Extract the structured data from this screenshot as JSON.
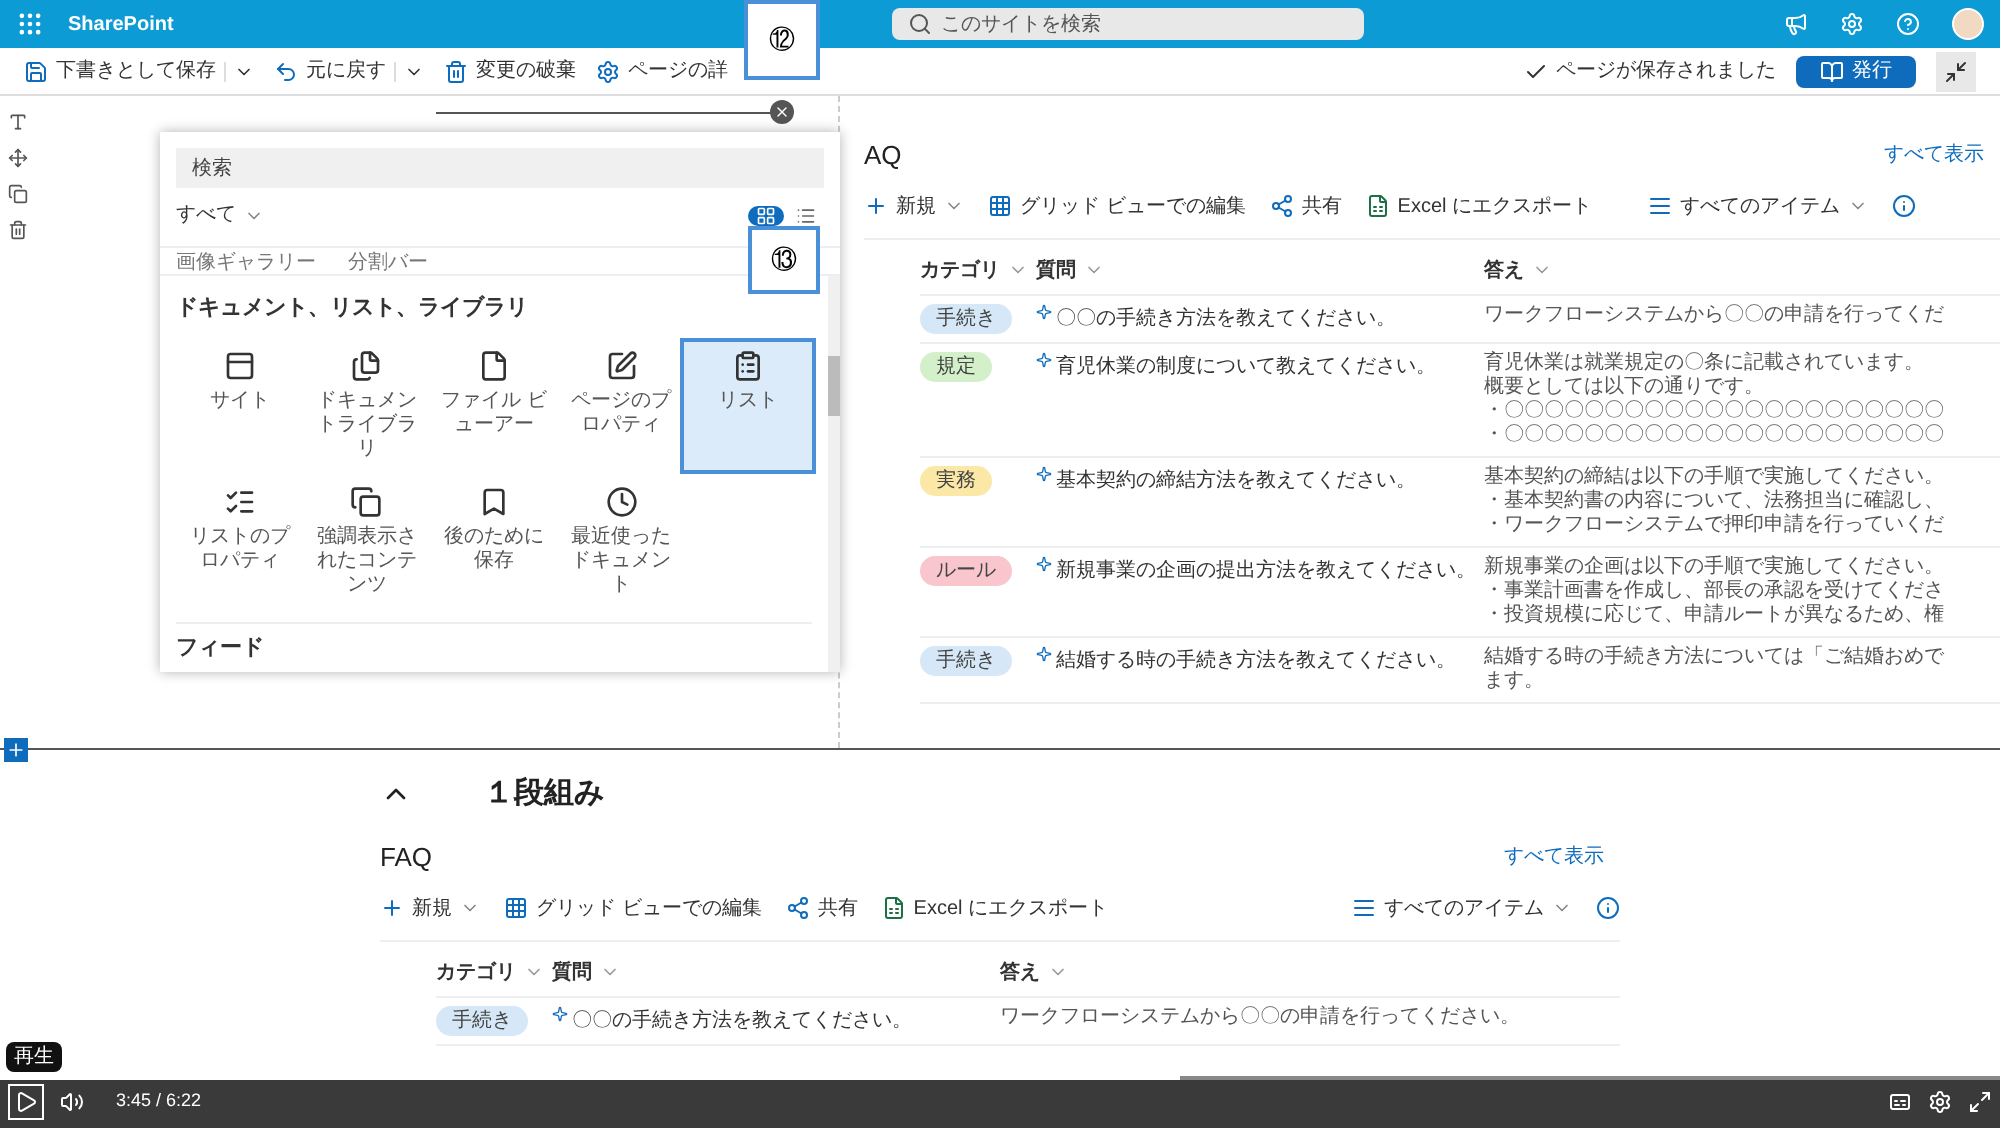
{
  "app_bar": {
    "app_name": "SharePoint",
    "search": {
      "placeholder": "このサイトを検索"
    }
  },
  "command_bar": {
    "items": [
      {
        "label": "下書きとして保存",
        "kind": "save",
        "menu": true
      },
      {
        "label": "元に戻す",
        "kind": "undo",
        "menu": true
      },
      {
        "label": "変更の破棄",
        "kind": "discard",
        "menu": false
      },
      {
        "label": "ページの詳",
        "kind": "details",
        "menu": false
      }
    ],
    "status": "ページが保存されました",
    "publish": "発行"
  },
  "annotations": [
    {
      "label": "⑫"
    },
    {
      "label": "⑬"
    }
  ],
  "picker": {
    "search_placeholder": "検索",
    "filter": "すべて",
    "grid_view": true,
    "partial_items": [
      "画像ギャラリー",
      "分割バー"
    ],
    "section": "ドキュメント、リスト、ライブラリ",
    "items": [
      {
        "label": "サイト",
        "kind": "site",
        "selected": false
      },
      {
        "label": "ドキュメントライブラリ",
        "kind": "library",
        "selected": false
      },
      {
        "label": "ファイル ビューアー",
        "kind": "file",
        "selected": false
      },
      {
        "label": "ページのプロパティ",
        "kind": "page",
        "selected": false
      },
      {
        "label": "リスト",
        "kind": "list",
        "selected": true
      },
      {
        "label": "リストのプロパティ",
        "kind": "listprops",
        "selected": false
      },
      {
        "label": "強調表示されたコンテンツ",
        "kind": "highlight",
        "selected": false
      },
      {
        "label": "後のために保存",
        "kind": "bookmark",
        "selected": false
      },
      {
        "label": "最近使ったドキュメント",
        "kind": "recent",
        "selected": false
      }
    ],
    "next_section": "フィード"
  },
  "faq_top": {
    "title": "AQ",
    "see_all": "すべて表示",
    "toolbar": [
      {
        "label": "新規",
        "kind": "new"
      },
      {
        "label": "グリッド ビューでの編集",
        "kind": "grid"
      },
      {
        "label": "共有",
        "kind": "share"
      },
      {
        "label": "Excel にエクスポート",
        "kind": "excel"
      }
    ],
    "view": "すべてのアイテム",
    "columns": [
      "カテゴリ",
      "質問",
      "答え"
    ],
    "rows": [
      {
        "category": "手続き",
        "color": "#d6e8f7",
        "question": "〇〇の手続き方法を教えてください。",
        "answer": [
          "ワークフローシステムから〇〇の申請を行ってくだ"
        ]
      },
      {
        "category": "規定",
        "color": "#d3f0cb",
        "question": "育児休業の制度について教えてください。",
        "answer": [
          "育児休業は就業規定の〇条に記載されています。",
          "概要としては以下の通りです。",
          "・〇〇〇〇〇〇〇〇〇〇〇〇〇〇〇〇〇〇〇〇〇〇",
          "・〇〇〇〇〇〇〇〇〇〇〇〇〇〇〇〇〇〇〇〇〇〇"
        ]
      },
      {
        "category": "実務",
        "color": "#fbe8a6",
        "question": "基本契約の締結方法を教えてください。",
        "answer": [
          "基本契約の締結は以下の手順で実施してください。",
          "・基本契約書の内容について、法務担当に確認し、",
          "・ワークフローシステムで押印申請を行っていくだ"
        ]
      },
      {
        "category": "ルール",
        "color": "#f8c6cc",
        "question": "新規事業の企画の提出方法を教えてください。",
        "answer": [
          "新規事業の企画は以下の手順で実施してください。",
          "・事業計画書を作成し、部長の承認を受けてくださ",
          "・投資規模に応じて、申請ルートが異なるため、権"
        ]
      },
      {
        "category": "手続き",
        "color": "#d6e8f7",
        "question": "結婚する時の手続き方法を教えてください。",
        "answer": [
          "結婚する時の手続き方法については「ご結婚おめで",
          "ます。"
        ]
      }
    ]
  },
  "section2": {
    "title": "１段組み",
    "faq": {
      "title": "FAQ",
      "see_all": "すべて表示",
      "toolbar": [
        {
          "label": "新規",
          "kind": "new"
        },
        {
          "label": "グリッド ビューでの編集",
          "kind": "grid"
        },
        {
          "label": "共有",
          "kind": "share"
        },
        {
          "label": "Excel にエクスポート",
          "kind": "excel"
        }
      ],
      "view": "すべてのアイテム",
      "columns": [
        "カテゴリ",
        "質問",
        "答え"
      ],
      "rows": [
        {
          "category": "手続き",
          "color": "#d6e8f7",
          "question": "〇〇の手続き方法を教えてください。",
          "answer": [
            "ワークフローシステムから〇〇の申請を行ってください。"
          ]
        }
      ]
    }
  },
  "player": {
    "tooltip": "再生",
    "time": "3:45 / 6:22",
    "progress": {
      "level": 0.59
    }
  }
}
